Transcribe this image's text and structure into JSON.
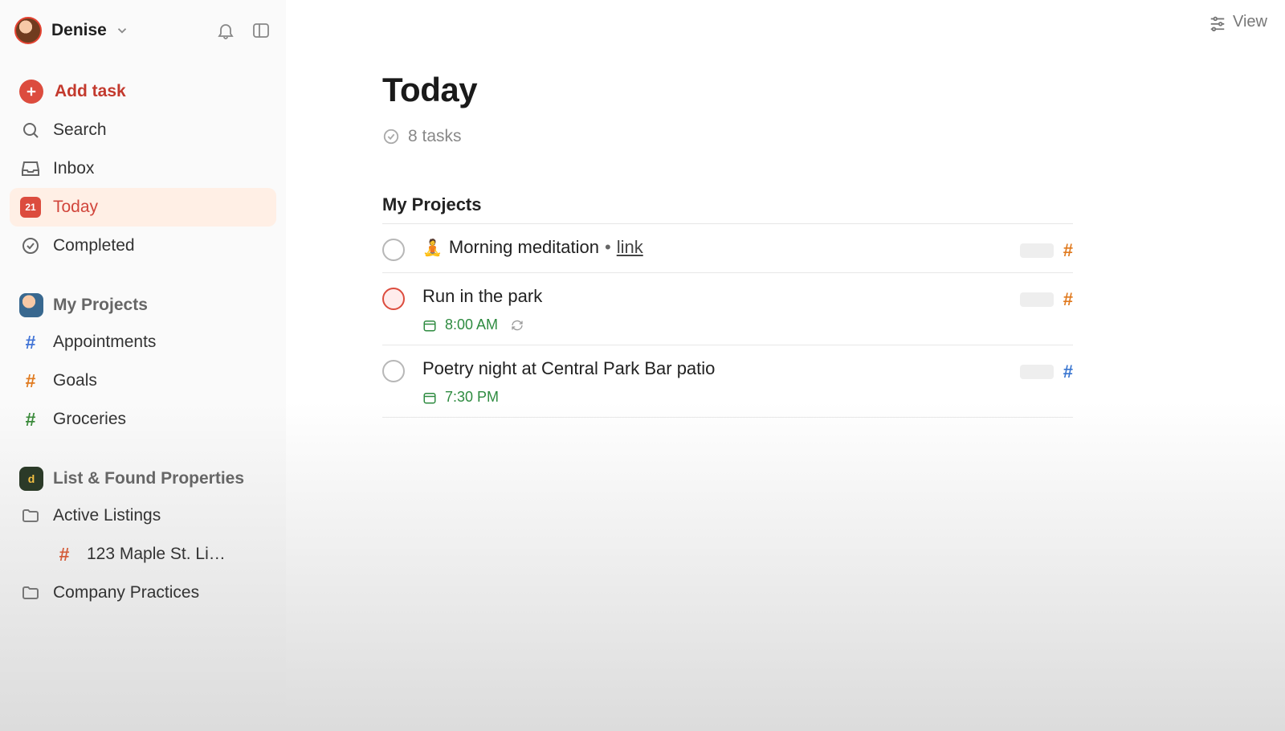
{
  "user": {
    "name": "Denise"
  },
  "sidebar": {
    "add_task_label": "Add task",
    "search_label": "Search",
    "inbox_label": "Inbox",
    "today_label": "Today",
    "today_badge": "21",
    "completed_label": "Completed",
    "my_projects_heading": "My Projects",
    "projects": [
      {
        "label": "Appointments",
        "color": "blue"
      },
      {
        "label": "Goals",
        "color": "orange"
      },
      {
        "label": "Groceries",
        "color": "green"
      }
    ],
    "workspace_heading": "List & Found Properties",
    "workspace_brand_letter": "d",
    "active_listings_label": "Active Listings",
    "listing_label": "123 Maple St. Li…",
    "company_practices_label": "Company Practices"
  },
  "topbar": {
    "view_label": "View"
  },
  "main": {
    "title": "Today",
    "task_count_text": "8 tasks",
    "section_heading": "My Projects",
    "tasks": [
      {
        "emoji": "🧘",
        "title": "Morning meditation",
        "separator": "•",
        "link_text": "link",
        "priority": false,
        "time": null,
        "recurring": false,
        "project_color": "orange"
      },
      {
        "emoji": "",
        "title": "Run in the park",
        "priority": true,
        "time": "8:00 AM",
        "recurring": true,
        "project_color": "orange"
      },
      {
        "emoji": "",
        "title": "Poetry night at Central Park Bar patio",
        "priority": false,
        "time": "7:30 PM",
        "recurring": false,
        "project_color": "blue"
      }
    ]
  }
}
